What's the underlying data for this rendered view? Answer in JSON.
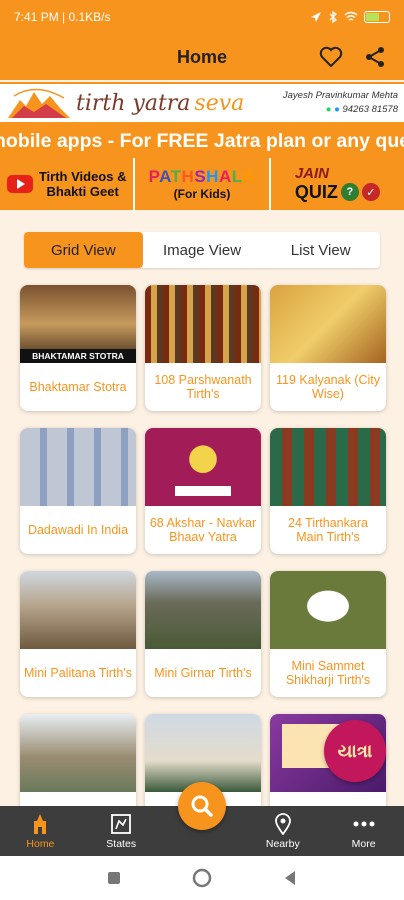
{
  "status_bar": {
    "time_info": "7:41 PM | 0.1KB/s",
    "battery_level": 0.55
  },
  "app_bar": {
    "title": "Home"
  },
  "banner": {
    "brand_main": "tirth yatra",
    "brand_accent": "seva",
    "contact_name": "Jayesh Pravinkumar Mehta",
    "contact_phone": "94263 81578"
  },
  "marquee": {
    "text": "nobile apps - For FREE Jatra plan or any quer"
  },
  "quick_links": {
    "videos_line1": "Tirth Videos &",
    "videos_line2": "Bhakti Geet",
    "pathshala_title": "PATHSHALA",
    "pathshala_sub": "(For Kids)",
    "quiz_top": "JAIN",
    "quiz_word": "QUIZ"
  },
  "view_tabs": [
    "Grid View",
    "Image View",
    "List View"
  ],
  "active_view": "Grid View",
  "grid": [
    {
      "label": "Bhaktamar Stotra",
      "image_caption": "BHAKTAMAR STOTRA"
    },
    {
      "label": "108 Parshwanath Tirth's"
    },
    {
      "label": "119 Kalyanak (City Wise)"
    },
    {
      "label": "Dadawadi In India"
    },
    {
      "label": "68 Akshar - Navkar Bhaav Yatra"
    },
    {
      "label": "24 Tirthankara Main Tirth's"
    },
    {
      "label": "Mini Palitana Tirth's"
    },
    {
      "label": "Mini Girnar Tirth's"
    },
    {
      "label": "Mini Sammet Shikharji Tirth's"
    },
    {
      "label": ""
    },
    {
      "label": ""
    },
    {
      "label": ""
    }
  ],
  "floating_badge": {
    "text": "યાત્રા"
  },
  "bottom_nav": {
    "items": [
      {
        "label": "Home",
        "icon": "temple-icon"
      },
      {
        "label": "States",
        "icon": "map-icon"
      },
      {
        "label": "Nearby",
        "icon": "location-pin-icon"
      },
      {
        "label": "More",
        "icon": "more-dots-icon"
      }
    ]
  },
  "colors": {
    "primary": "#f7941d",
    "background": "#fdf1e3",
    "nav_bar": "#3d3d3d"
  }
}
